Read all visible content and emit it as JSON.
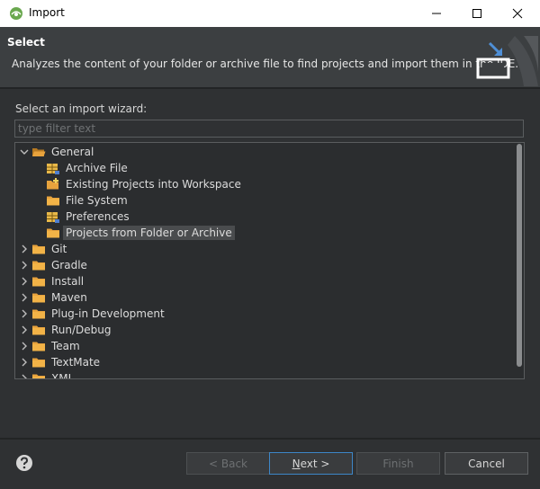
{
  "window": {
    "title": "Import"
  },
  "header": {
    "title": "Select",
    "description": "Analyzes the content of your folder or archive file to find projects and import them in the IDE."
  },
  "wizard": {
    "label": "Select an import wizard:",
    "filter_placeholder": "type filter text"
  },
  "tree": {
    "items": [
      {
        "label": "General",
        "expanded": true,
        "level": 0,
        "icon": "folder-open-icon"
      },
      {
        "label": "Archive File",
        "level": 1,
        "icon": "archive-icon"
      },
      {
        "label": "Existing Projects into Workspace",
        "level": 1,
        "icon": "project-folder-icon"
      },
      {
        "label": "File System",
        "level": 1,
        "icon": "folder-icon"
      },
      {
        "label": "Preferences",
        "level": 1,
        "icon": "preferences-icon"
      },
      {
        "label": "Projects from Folder or Archive",
        "level": 1,
        "icon": "folder-icon",
        "selected": true
      },
      {
        "label": "Git",
        "level": 0,
        "icon": "folder-icon"
      },
      {
        "label": "Gradle",
        "level": 0,
        "icon": "folder-icon"
      },
      {
        "label": "Install",
        "level": 0,
        "icon": "folder-icon"
      },
      {
        "label": "Maven",
        "level": 0,
        "icon": "folder-icon"
      },
      {
        "label": "Plug-in Development",
        "level": 0,
        "icon": "folder-icon"
      },
      {
        "label": "Run/Debug",
        "level": 0,
        "icon": "folder-icon"
      },
      {
        "label": "Team",
        "level": 0,
        "icon": "folder-icon"
      },
      {
        "label": "TextMate",
        "level": 0,
        "icon": "folder-icon"
      },
      {
        "label": "XML",
        "level": 0,
        "icon": "folder-icon"
      }
    ]
  },
  "buttons": {
    "back": "< Back",
    "next_prefix": "",
    "next_mnemonic": "N",
    "next_rest": "ext >",
    "finish": "Finish",
    "cancel": "Cancel"
  },
  "colors": {
    "accent": "#3d86c7",
    "folder": "#e8a33d",
    "background": "#2f3133"
  }
}
